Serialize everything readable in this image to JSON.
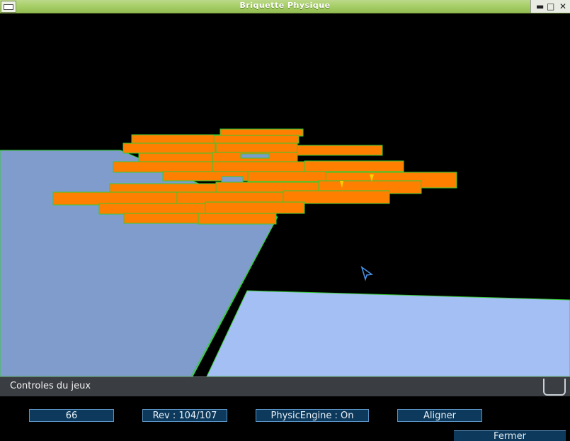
{
  "window": {
    "title": "Briquette Physique"
  },
  "controls": {
    "header": "Controles du jeux",
    "counter": "66",
    "revision": "Rev : 104/107",
    "physic_engine": "PhysicEngine : On",
    "align": "Aligner",
    "close": "Fermer"
  },
  "colors": {
    "titlebar": "#a8cf6a",
    "brick": "#ff7f00",
    "brick_edge": "#33cc33",
    "floor_left": "#7f9ccd",
    "floor_right": "#a4bff3",
    "button_bg": "#0d3a5c",
    "button_border": "#5b94c4"
  },
  "icons": [
    "window-menu-icon",
    "minimize-icon",
    "maximize-icon",
    "close-icon",
    "cursor-arrow-icon",
    "collapse-icon"
  ]
}
